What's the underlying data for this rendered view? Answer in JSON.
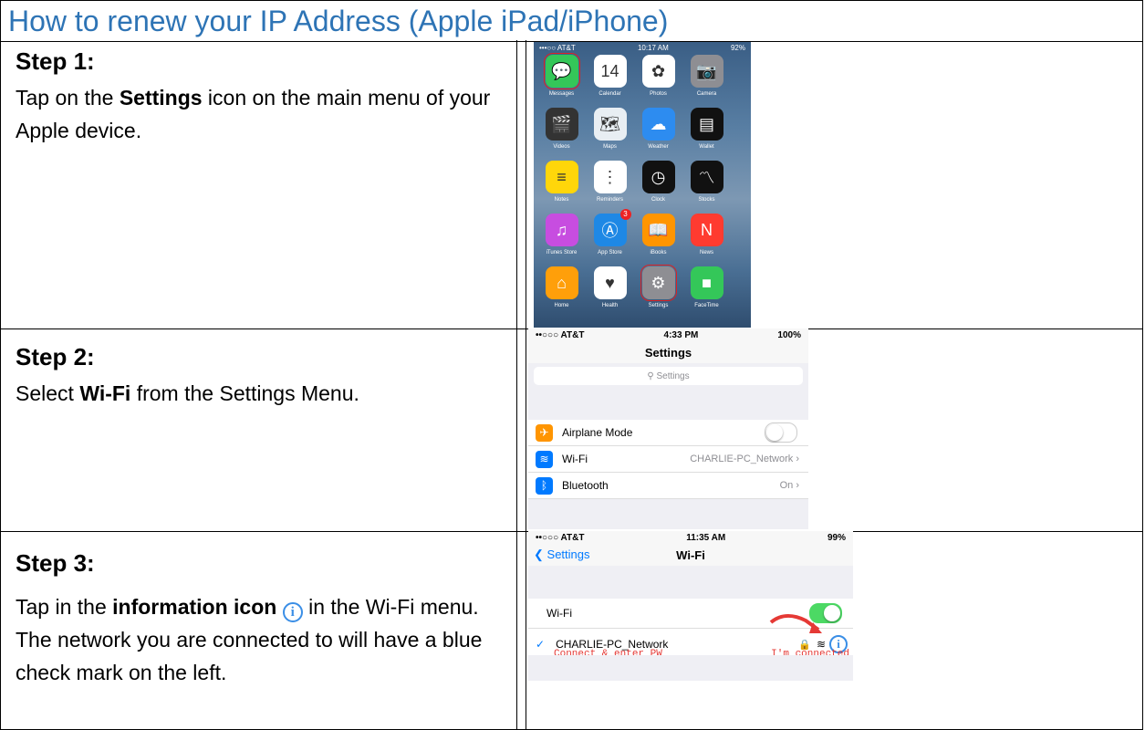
{
  "title": "How to renew your IP Address (Apple iPad/iPhone)",
  "step1": {
    "heading": "Step 1:",
    "text_before": "Tap on the ",
    "bold": "Settings",
    "text_after": " icon on the main menu of your Apple device.",
    "phone": {
      "carrier": "•••○○ AT&T",
      "time": "10:17 AM",
      "battery": "92%",
      "apps": [
        {
          "label": "Messages",
          "icon": "messages-icon",
          "color": "#34c759",
          "glyph": "💬",
          "highlight": true
        },
        {
          "label": "Calendar",
          "icon": "calendar-icon",
          "color": "#ffffff",
          "glyph": "14"
        },
        {
          "label": "Photos",
          "icon": "photos-icon",
          "color": "#ffffff",
          "glyph": "✿"
        },
        {
          "label": "Camera",
          "icon": "camera-icon",
          "color": "#8e8e93",
          "glyph": "📷"
        },
        {
          "label": "Videos",
          "icon": "videos-icon",
          "color": "#333333",
          "glyph": "🎬"
        },
        {
          "label": "Maps",
          "icon": "maps-icon",
          "color": "#e8eef3",
          "glyph": "🗺"
        },
        {
          "label": "Weather",
          "icon": "weather-icon",
          "color": "#2d8cf0",
          "glyph": "☁"
        },
        {
          "label": "Wallet",
          "icon": "wallet-icon",
          "color": "#111111",
          "glyph": "▤"
        },
        {
          "label": "Notes",
          "icon": "notes-icon",
          "color": "#ffd60a",
          "glyph": "≡"
        },
        {
          "label": "Reminders",
          "icon": "reminders-icon",
          "color": "#ffffff",
          "glyph": "⋮"
        },
        {
          "label": "Clock",
          "icon": "clock-icon",
          "color": "#111111",
          "glyph": "◷"
        },
        {
          "label": "Stocks",
          "icon": "stocks-icon",
          "color": "#111111",
          "glyph": "〽"
        },
        {
          "label": "iTunes Store",
          "icon": "itunes-icon",
          "color": "#c74de0",
          "glyph": "♫"
        },
        {
          "label": "App Store",
          "icon": "appstore-icon",
          "color": "#1e88e5",
          "glyph": "Ⓐ",
          "badge": "3"
        },
        {
          "label": "iBooks",
          "icon": "ibooks-icon",
          "color": "#ff9500",
          "glyph": "📖"
        },
        {
          "label": "News",
          "icon": "news-icon",
          "color": "#ff3b30",
          "glyph": "N"
        },
        {
          "label": "Home",
          "icon": "home-icon",
          "color": "#ff9f0a",
          "glyph": "⌂"
        },
        {
          "label": "Health",
          "icon": "health-icon",
          "color": "#ffffff",
          "glyph": "♥"
        },
        {
          "label": "Settings",
          "icon": "settings-gear-icon",
          "color": "#8e8e93",
          "glyph": "⚙",
          "highlight": true
        },
        {
          "label": "FaceTime",
          "icon": "facetime-icon",
          "color": "#34c759",
          "glyph": "■"
        }
      ]
    }
  },
  "step2": {
    "heading": "Step 2:",
    "text_before": "Select ",
    "bold": "Wi-Fi",
    "text_after": " from the Settings Menu.",
    "phone": {
      "carrier": "••○○○ AT&T",
      "time": "4:33 PM",
      "battery": "100%",
      "nav_title": "Settings",
      "search_placeholder": "Settings",
      "rows": [
        {
          "label": "Airplane Mode",
          "icon": "airplane-icon",
          "color": "#ff9500",
          "glyph": "✈",
          "toggle": true
        },
        {
          "label": "Wi-Fi",
          "icon": "wifi-icon",
          "color": "#007aff",
          "glyph": "≋",
          "value": "CHARLIE-PC_Network"
        },
        {
          "label": "Bluetooth",
          "icon": "bluetooth-icon",
          "color": "#007aff",
          "glyph": "ᛒ",
          "value": "On"
        }
      ]
    }
  },
  "step3": {
    "heading": "Step 3:",
    "text_before": "Tap in the ",
    "bold": "information icon",
    "text_after": " in the Wi-Fi menu.",
    "text_2": "The network you are connected to will have a blue check mark on the left.",
    "phone": {
      "carrier": "••○○○ AT&T",
      "time": "11:35 AM",
      "battery": "99%",
      "back_label": "Settings",
      "nav_title": "Wi-Fi",
      "wifi_label": "Wi-Fi",
      "network": "CHARLIE-PC_Network",
      "note_left": "Connect & enter PW",
      "note_right": "I'm connected"
    }
  }
}
